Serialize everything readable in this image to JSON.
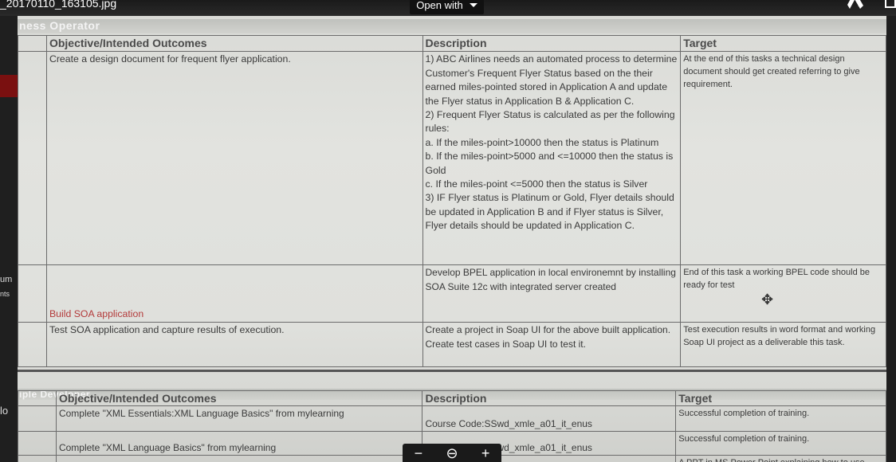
{
  "viewer": {
    "filename": "_20170110_163105.jpg",
    "open_with": "Open with",
    "side_labels": [
      "um",
      "nts",
      "lo"
    ]
  },
  "section1": {
    "band_title": "ness Operator",
    "headers": [
      "Objective/Intended Outcomes",
      "Description",
      "Target"
    ],
    "rows": [
      {
        "objective": "Create a design document for frequent flyer application.",
        "description": [
          "1) ABC Airlines needs an automated process to determine Customer's Frequent Flyer Status based on the their earned miles-pointed stored in Application A and update the Flyer status in Application B & Application C.",
          "2) Frequent Flyer Status is calculated as per the following rules:",
          "a. If the miles-point>10000 then the status is Platinum",
          "b. If the miles-point>5000 and <=10000 then the status is Gold",
          "c. If the miles-point <=5000 then the status is Silver",
          "3) IF Flyer status is Platinum or Gold, Flyer details should be updated in Application B and if Flyer status is Silver, Flyer details should be updated in Application C."
        ],
        "target": "At the end of this tasks a technical design document should get created referring to give requirement."
      },
      {
        "objective": "Build SOA application",
        "description": "Develop BPEL application in local environemnt by installing SOA Suite 12c with integrated server created",
        "target": "End of this task a working BPEL code should be ready for test"
      },
      {
        "objective": "Test SOA application and capture results of execution.",
        "description": "Create a project in Soap UI for the above built application. Create test cases in Soap UI to test it.",
        "target": "Test execution results in word format and working Soap UI project as a deliverable this task."
      }
    ]
  },
  "section2": {
    "band_title": "iple Developer",
    "headers": [
      "Objective/Intended Outcomes",
      "Description",
      "Target"
    ],
    "rows": [
      {
        "objective": "Complete \"XML Essentials:XML Language Basics\" from mylearning",
        "description": "Course Code:SSwd_xmle_a01_it_enus",
        "target": "Successful completion of training."
      },
      {
        "objective": "Complete \"XML Language Basics\" from mylearning",
        "description": "Course Code:SSwd_xmle_a01_it_enus",
        "target": "Successful completion of training."
      },
      {
        "objective": "",
        "description": "",
        "target": "A PPT in MS Power Point explaining how to use"
      }
    ]
  },
  "zoom": {
    "minus": "−",
    "search": "⊖",
    "plus": "+"
  }
}
